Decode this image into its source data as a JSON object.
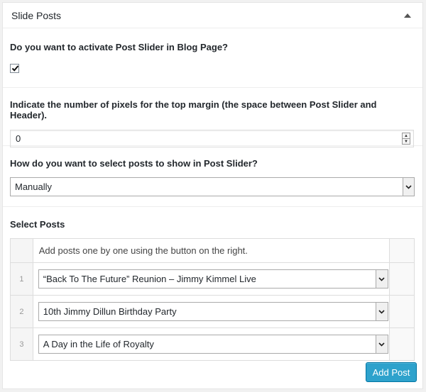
{
  "panel": {
    "title": "Slide Posts"
  },
  "activate": {
    "question": "Do you want to activate Post Slider in Blog Page?",
    "checked": true
  },
  "margin": {
    "question": "Indicate the number of pixels for the top margin (the space between Post Slider and Header).",
    "value": "0"
  },
  "selection": {
    "question": "How do you want to select posts to show in Post Slider?",
    "selected": "Manually"
  },
  "posts": {
    "heading": "Select Posts",
    "hint": "Add posts one by one using the button on the right.",
    "rows": [
      {
        "num": "1",
        "title": "“Back To The Future” Reunion – Jimmy Kimmel Live"
      },
      {
        "num": "2",
        "title": "10th Jimmy Dillun Birthday Party"
      },
      {
        "num": "3",
        "title": "A Day in the Life of Royalty"
      }
    ],
    "add_label": "Add Post"
  },
  "icons": {
    "collapse": "collapse-arrow-icon",
    "checkmark": "checkmark-icon",
    "dropdown": "chevron-down-icon",
    "spinner": "spinner-arrows-icon"
  },
  "colors": {
    "accent": "#2ea2cc",
    "accent_border": "#0074a2"
  }
}
